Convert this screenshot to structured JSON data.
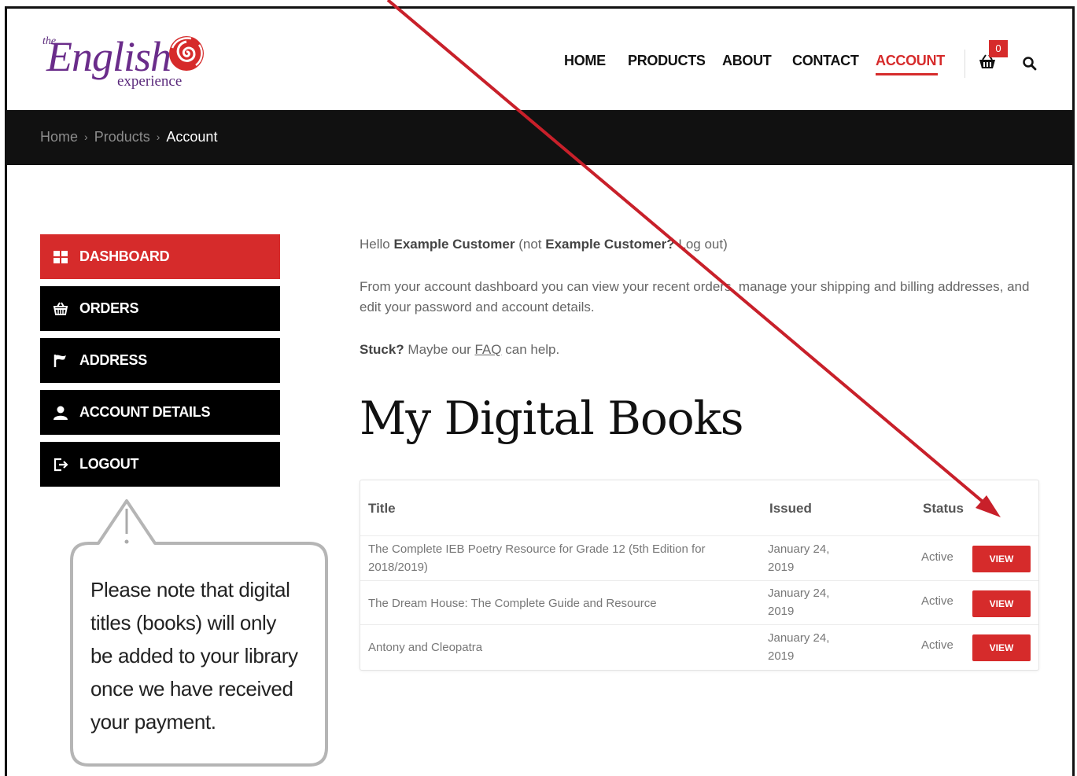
{
  "brand": {
    "the": "the",
    "name": "English",
    "sub": "experience",
    "purple": "#6a2c8a",
    "rose": "#d62b2b"
  },
  "nav": {
    "items": [
      "HOME",
      "PRODUCTS",
      "ABOUT",
      "CONTACT",
      "ACCOUNT"
    ],
    "active": "ACCOUNT",
    "cart_count": "0",
    "accent": "#d62b2b"
  },
  "breadcrumb": {
    "items": [
      "Home",
      "Products",
      "Account"
    ],
    "separator": "›"
  },
  "sidebar": {
    "items": [
      {
        "label": "DASHBOARD",
        "icon": "dashboard-grid-icon",
        "active": true
      },
      {
        "label": "ORDERS",
        "icon": "basket-icon",
        "active": false
      },
      {
        "label": "ADDRESS",
        "icon": "flag-icon",
        "active": false
      },
      {
        "label": "ACCOUNT DETAILS",
        "icon": "user-icon",
        "active": false
      },
      {
        "label": "LOGOUT",
        "icon": "logout-icon",
        "active": false
      }
    ]
  },
  "callout": {
    "icon": "exclamation-icon",
    "text": "Please note that digital titles (books) will only be added to your library once we have received your payment.",
    "lines": [
      "Please note that digital",
      "titles (books) will only",
      "be added to your library",
      "once we have received",
      "your payment."
    ]
  },
  "main": {
    "greeting": {
      "hello": "Hello",
      "name": "Example Customer",
      "not_open": "(not",
      "not_name": "Example Customer?",
      "logout": "Log out)"
    },
    "intro": "From your account dashboard you can view your recent orders, manage your shipping and billing addresses, and edit your password and account details.",
    "stuck": {
      "bold": "Stuck?",
      "pre": "Maybe our",
      "link": "FAQ",
      "post": "can help."
    },
    "heading": "My Digital Books",
    "table": {
      "headers": {
        "title": "Title",
        "issued": "Issued",
        "status": "Status"
      },
      "rows": [
        {
          "title": "The Complete IEB Poetry Resource for Grade 12 (5th Edition for 2018/2019)",
          "issued": "January 24, 2019",
          "status": "Active",
          "action": "VIEW"
        },
        {
          "title": "The Dream House: The Complete Guide and Resource",
          "issued": "January 24, 2019",
          "status": "Active",
          "action": "VIEW"
        },
        {
          "title": "Antony and Cleopatra",
          "issued": "January 24, 2019",
          "status": "Active",
          "action": "VIEW"
        }
      ]
    }
  },
  "annotation": {
    "arrow_color": "#c8202a"
  }
}
